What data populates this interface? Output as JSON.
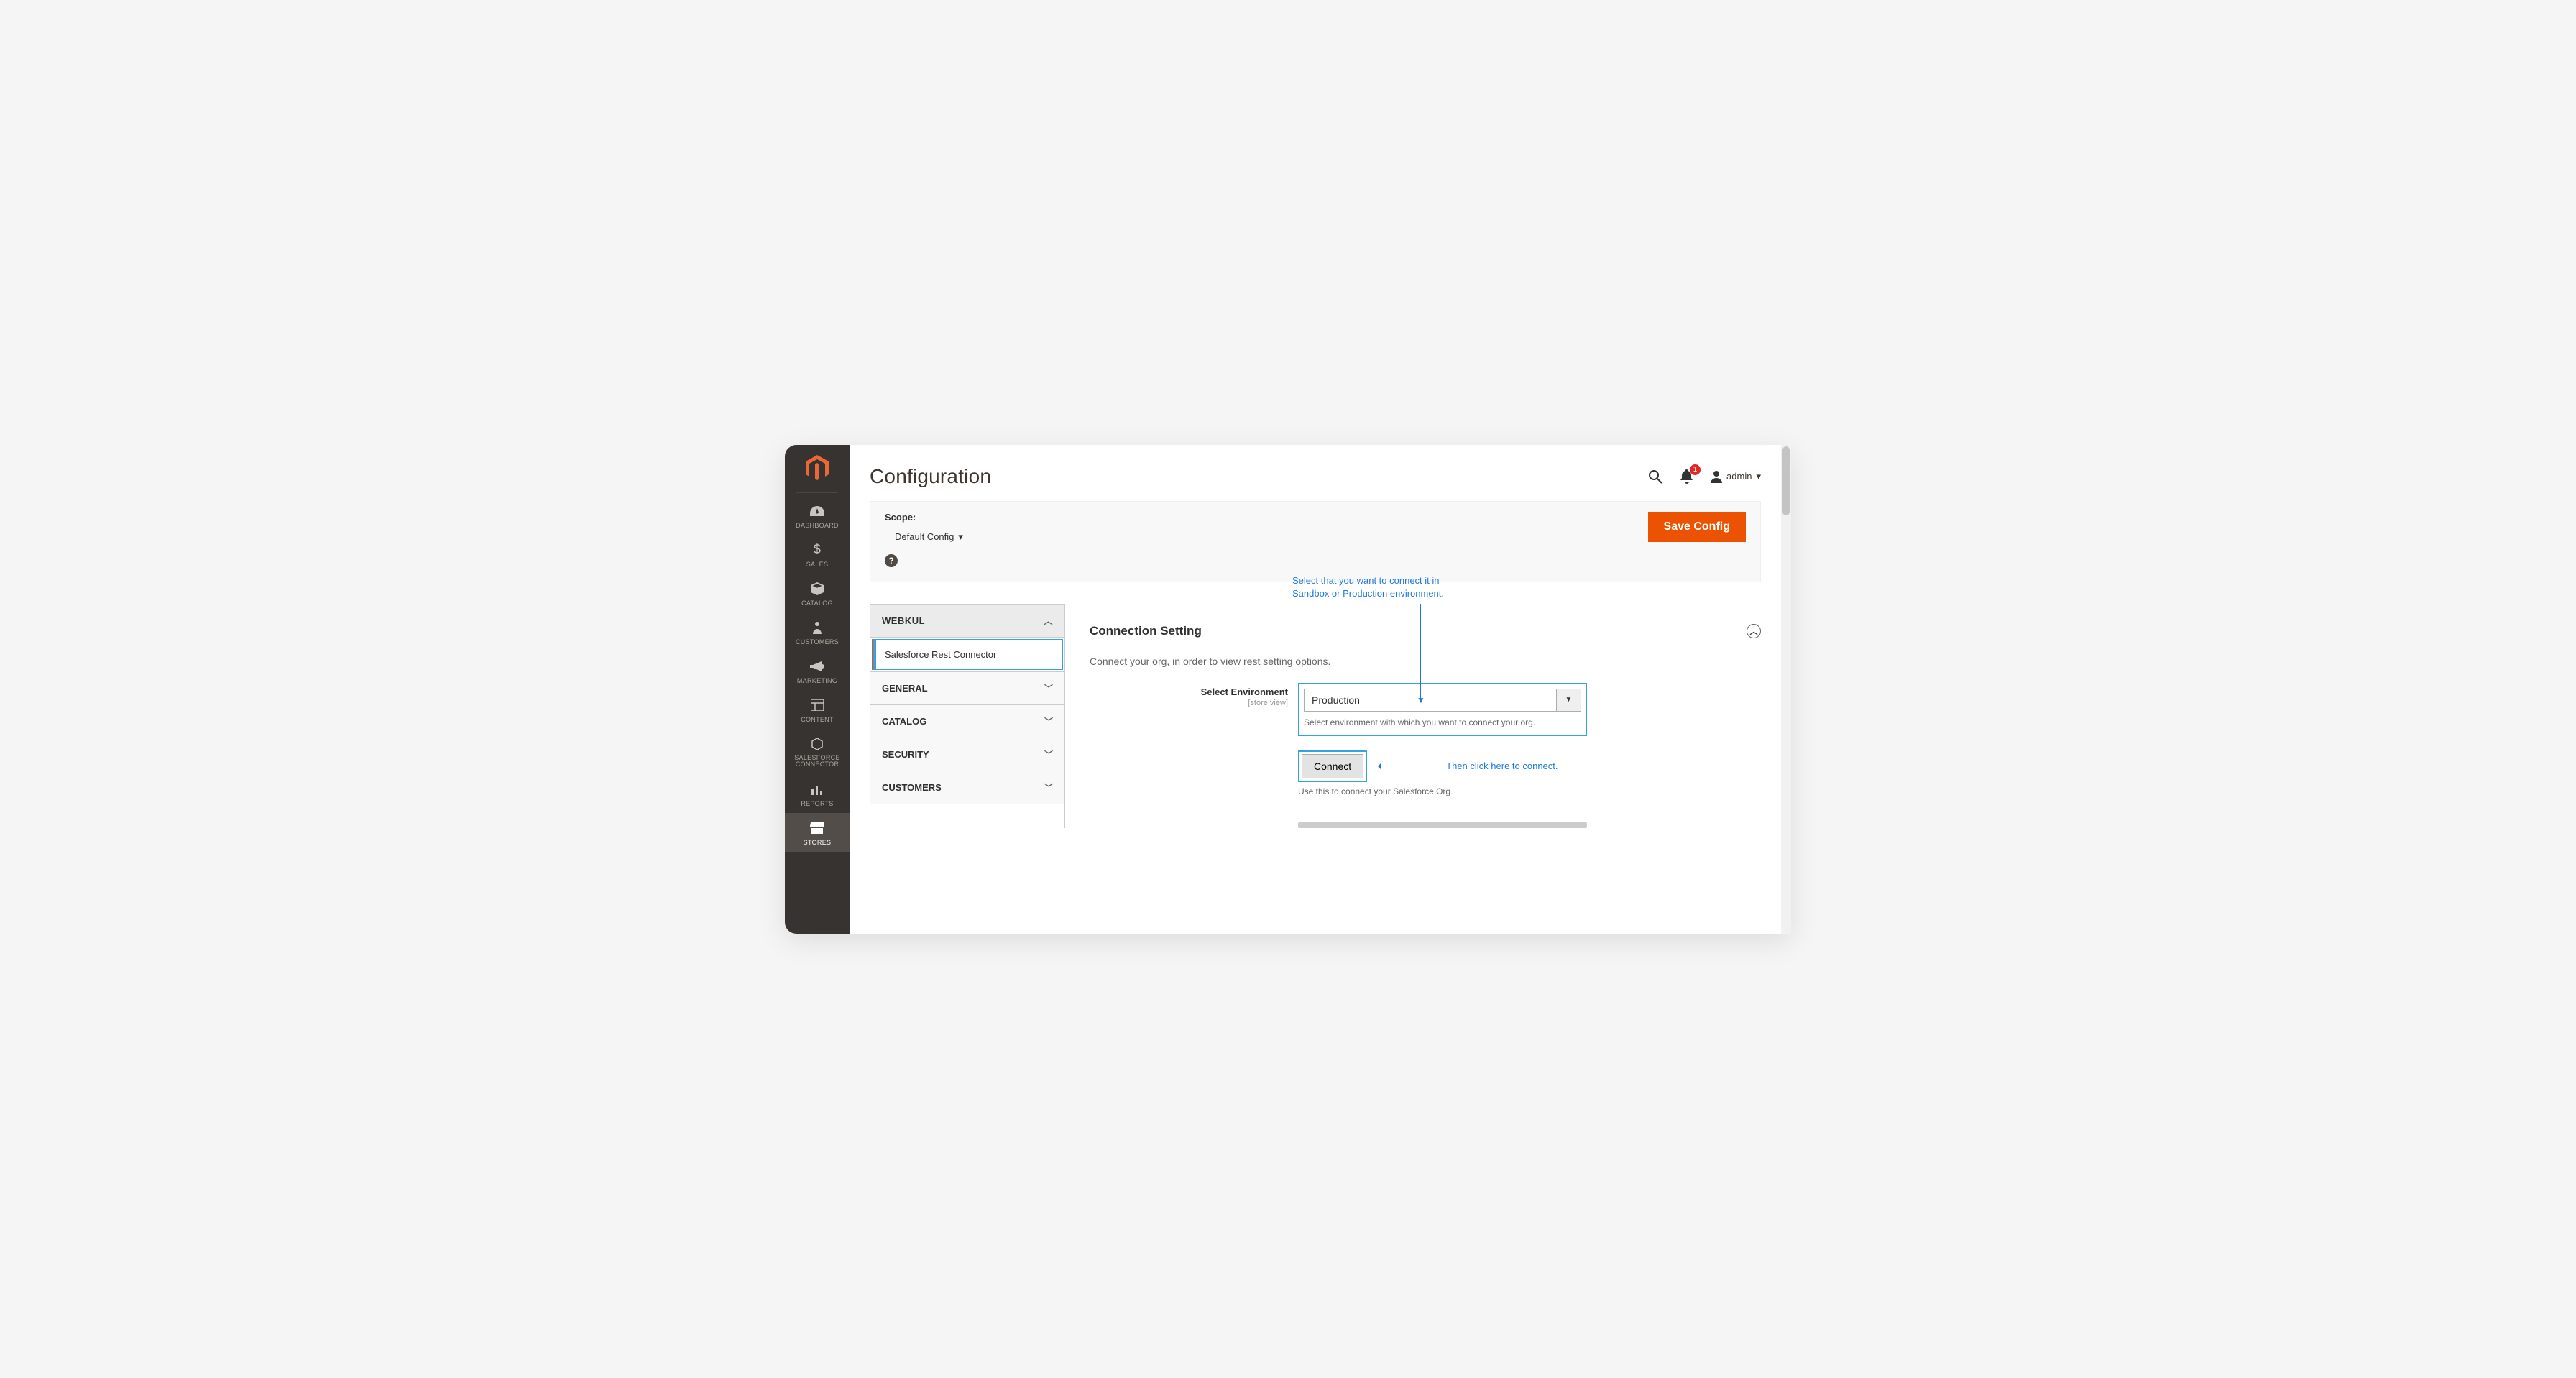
{
  "sidebar": {
    "items": [
      {
        "label": "DASHBOARD",
        "icon": "gauge"
      },
      {
        "label": "SALES",
        "icon": "dollar"
      },
      {
        "label": "CATALOG",
        "icon": "box"
      },
      {
        "label": "CUSTOMERS",
        "icon": "person"
      },
      {
        "label": "MARKETING",
        "icon": "megaphone"
      },
      {
        "label": "CONTENT",
        "icon": "layout"
      },
      {
        "label": "SALESFORCE CONNECTOR",
        "icon": "hex"
      },
      {
        "label": "REPORTS",
        "icon": "bars"
      },
      {
        "label": "STORES",
        "icon": "store"
      }
    ]
  },
  "header": {
    "title": "Configuration",
    "notif_count": "1",
    "user": "admin"
  },
  "toolbar": {
    "scope_label": "Scope:",
    "scope_value": "Default Config",
    "save_label": "Save Config"
  },
  "tabs": {
    "section1": "WEBKUL",
    "sub1": "Salesforce Rest Connector",
    "t_general": "GENERAL",
    "t_catalog": "CATALOG",
    "t_security": "SECURITY",
    "t_customers": "CUSTOMERS"
  },
  "panel": {
    "title": "Connection Setting",
    "desc": "Connect your org, in order to view rest setting options.",
    "env_label": "Select Environment",
    "env_scope": "[store view]",
    "env_value": "Production",
    "env_hint": "Select environment with which you want to connect your org.",
    "connect_label": "Connect",
    "connect_hint": "Use this to connect your Salesforce Org."
  },
  "annotations": {
    "top1": "Select that you want to connect it in",
    "top2": "Sandbox or Production environment.",
    "right": "Then click here to connect."
  }
}
